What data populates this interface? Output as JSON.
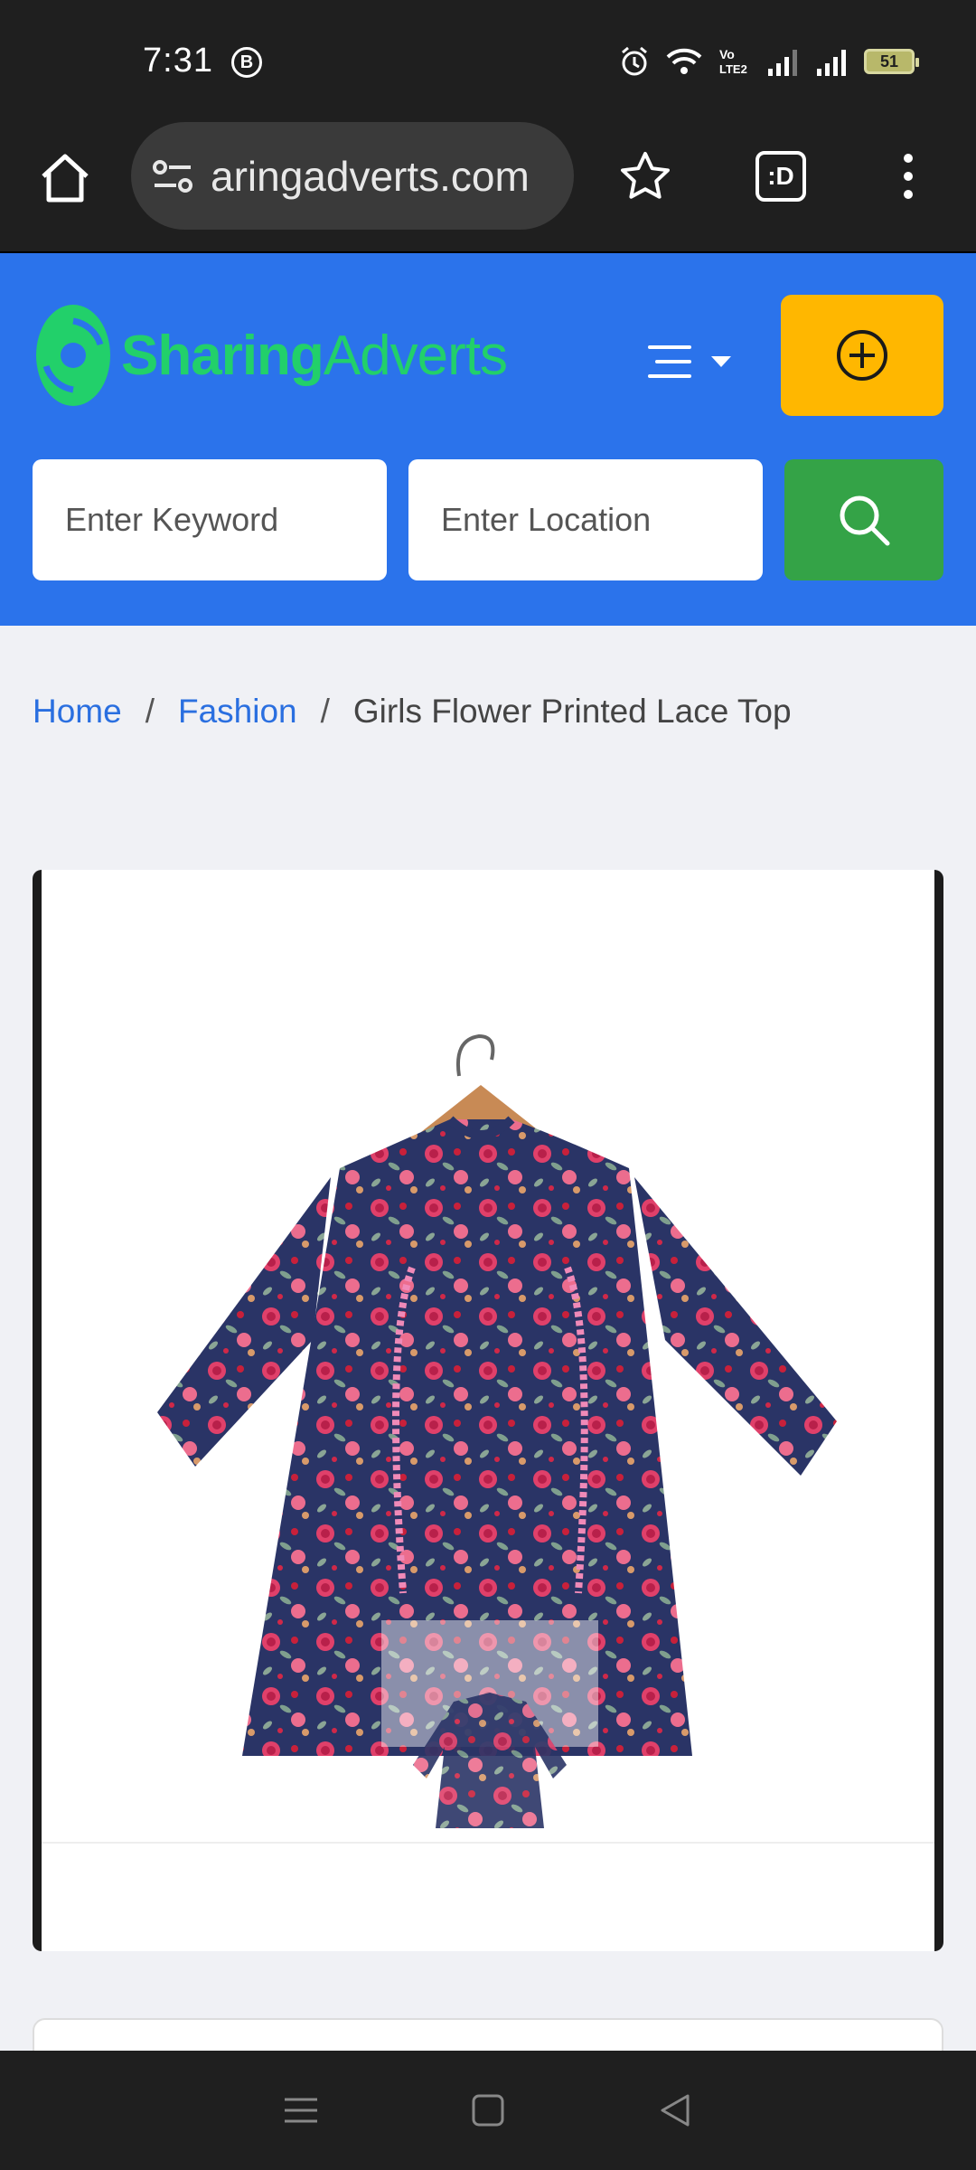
{
  "status_bar": {
    "time": "7:31",
    "b_badge": "B",
    "network": "Vo LTE2",
    "battery": "51"
  },
  "browser": {
    "url": "aringadverts.com",
    "tabs_label": ":D"
  },
  "site": {
    "logo_bold": "Sharing",
    "logo_light": "Adverts",
    "brand_color": "#22d06a",
    "header_color": "#2b73eb",
    "post_button_color": "#ffb700",
    "search_button_color": "#34a347"
  },
  "search": {
    "keyword_placeholder": "Enter Keyword",
    "location_placeholder": "Enter Location"
  },
  "breadcrumb": {
    "home": "Home",
    "category": "Fashion",
    "current": "Girls Flower Printed Lace Top",
    "separator": "/"
  }
}
